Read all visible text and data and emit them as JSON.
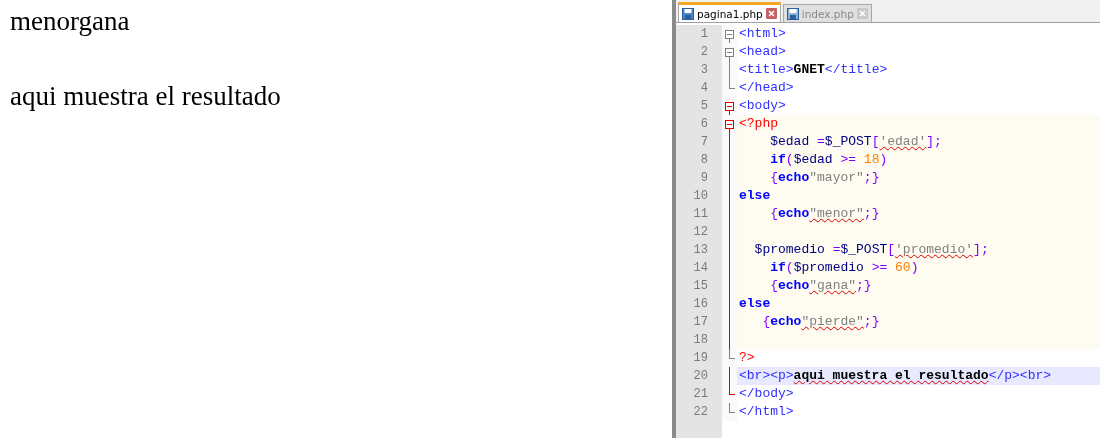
{
  "page_output": {
    "lines": [
      "menorgana",
      "aqui muestra el resultado"
    ]
  },
  "editor": {
    "tabs": [
      {
        "label": "pagina1.php",
        "selected": true
      },
      {
        "label": "index.php",
        "selected": false
      }
    ],
    "lines": [
      {
        "number": "1",
        "fold_start": true,
        "active_scope": false,
        "php_block": false,
        "current": false,
        "tokens": [
          {
            "kind": "tag",
            "text": "<html>"
          }
        ]
      },
      {
        "number": "2",
        "fold_start": true,
        "active_scope": false,
        "php_block": false,
        "current": false,
        "tokens": [
          {
            "kind": "tag",
            "text": "<head>"
          }
        ]
      },
      {
        "number": "3",
        "fold_start": false,
        "fold_end": false,
        "active_scope": false,
        "php_block": false,
        "current": false,
        "tokens": [
          {
            "kind": "tag",
            "text": "<title>"
          },
          {
            "kind": "text",
            "text": "GNET"
          },
          {
            "kind": "tag",
            "text": "</title>"
          }
        ]
      },
      {
        "number": "4",
        "fold_start": false,
        "fold_end": true,
        "active_scope": false,
        "php_block": false,
        "current": false,
        "tokens": [
          {
            "kind": "tag",
            "text": "</head>"
          }
        ]
      },
      {
        "number": "5",
        "fold_start": true,
        "active_scope": true,
        "php_block": false,
        "current": false,
        "tokens": [
          {
            "kind": "tag",
            "text": "<body>"
          }
        ]
      },
      {
        "number": "6",
        "fold_start": true,
        "active_scope": true,
        "php_block": true,
        "current": false,
        "tokens": [
          {
            "kind": "php",
            "text": "<?php"
          }
        ]
      },
      {
        "number": "7",
        "fold_start": false,
        "fold_end": false,
        "active_scope": true,
        "php_block": true,
        "current": false,
        "tokens": [
          {
            "kind": "var",
            "text": "    $edad"
          },
          {
            "kind": "op",
            "text": " ="
          },
          {
            "kind": "var",
            "text": "$_POST"
          },
          {
            "kind": "op",
            "text": "["
          },
          {
            "kind": "string",
            "text": "'edad'",
            "spell": true
          },
          {
            "kind": "op",
            "text": "];"
          }
        ]
      },
      {
        "number": "8",
        "fold_start": false,
        "fold_end": false,
        "active_scope": true,
        "php_block": true,
        "current": false,
        "tokens": [
          {
            "kind": "keyword",
            "text": "    if"
          },
          {
            "kind": "op",
            "text": "("
          },
          {
            "kind": "var",
            "text": "$edad"
          },
          {
            "kind": "op",
            "text": " >= "
          },
          {
            "kind": "number",
            "text": "18"
          },
          {
            "kind": "op",
            "text": ")"
          }
        ]
      },
      {
        "number": "9",
        "fold_start": false,
        "fold_end": false,
        "active_scope": true,
        "php_block": true,
        "current": false,
        "tokens": [
          {
            "kind": "op",
            "text": "    {"
          },
          {
            "kind": "keyword",
            "text": "echo"
          },
          {
            "kind": "string",
            "text": "\"mayor\""
          },
          {
            "kind": "op",
            "text": ";}"
          }
        ]
      },
      {
        "number": "10",
        "fold_start": false,
        "fold_end": false,
        "active_scope": true,
        "php_block": true,
        "current": false,
        "tokens": [
          {
            "kind": "keyword",
            "text": "else"
          }
        ]
      },
      {
        "number": "11",
        "fold_start": false,
        "fold_end": false,
        "active_scope": true,
        "php_block": true,
        "current": false,
        "tokens": [
          {
            "kind": "op",
            "text": "    {"
          },
          {
            "kind": "keyword",
            "text": "echo"
          },
          {
            "kind": "string",
            "text": "\"menor\"",
            "spell": true
          },
          {
            "kind": "op",
            "text": ";}"
          }
        ]
      },
      {
        "number": "12",
        "fold_start": false,
        "fold_end": false,
        "active_scope": true,
        "php_block": true,
        "current": false
      },
      {
        "number": "13",
        "fold_start": false,
        "fold_end": false,
        "active_scope": true,
        "php_block": true,
        "current": false,
        "tokens": [
          {
            "kind": "var",
            "text": "  $promedio"
          },
          {
            "kind": "op",
            "text": " ="
          },
          {
            "kind": "var",
            "text": "$_POST"
          },
          {
            "kind": "op",
            "text": "["
          },
          {
            "kind": "string",
            "text": "'promedio'",
            "spell": true
          },
          {
            "kind": "op",
            "text": "];"
          }
        ]
      },
      {
        "number": "14",
        "fold_start": false,
        "fold_end": false,
        "active_scope": true,
        "php_block": true,
        "current": false,
        "tokens": [
          {
            "kind": "keyword",
            "text": "    if"
          },
          {
            "kind": "op",
            "text": "("
          },
          {
            "kind": "var",
            "text": "$promedio"
          },
          {
            "kind": "op",
            "text": " >= "
          },
          {
            "kind": "number",
            "text": "60"
          },
          {
            "kind": "op",
            "text": ")"
          }
        ]
      },
      {
        "number": "15",
        "fold_start": false,
        "fold_end": false,
        "active_scope": true,
        "php_block": true,
        "current": false,
        "tokens": [
          {
            "kind": "op",
            "text": "    {"
          },
          {
            "kind": "keyword",
            "text": "echo"
          },
          {
            "kind": "string",
            "text": "\"gana\"",
            "spell": true
          },
          {
            "kind": "op",
            "text": ";}"
          }
        ]
      },
      {
        "number": "16",
        "fold_start": false,
        "fold_end": false,
        "active_scope": true,
        "php_block": true,
        "current": false,
        "tokens": [
          {
            "kind": "keyword",
            "text": "else"
          }
        ]
      },
      {
        "number": "17",
        "fold_start": false,
        "fold_end": false,
        "active_scope": true,
        "php_block": true,
        "current": false,
        "tokens": [
          {
            "kind": "op",
            "text": "   {"
          },
          {
            "kind": "keyword",
            "text": "echo"
          },
          {
            "kind": "string",
            "text": "\"pierde\"",
            "spell": true
          },
          {
            "kind": "op",
            "text": ";}"
          }
        ]
      },
      {
        "number": "18",
        "fold_start": false,
        "fold_end": false,
        "active_scope": true,
        "php_block": true,
        "current": false
      },
      {
        "number": "19",
        "fold_start": false,
        "fold_end": true,
        "active_scope": false,
        "php_block": false,
        "current": false,
        "tokens": [
          {
            "kind": "php",
            "text": "?>"
          }
        ]
      },
      {
        "number": "20",
        "fold_start": false,
        "fold_end": false,
        "active_scope": true,
        "php_block": false,
        "current": true,
        "tokens": [
          {
            "kind": "tag",
            "text": "<br><p>"
          },
          {
            "kind": "text",
            "text": "aqui muestra el resultado",
            "spell": true
          },
          {
            "kind": "tag",
            "text": "</p><br>"
          }
        ]
      },
      {
        "number": "21",
        "fold_start": false,
        "fold_end": true,
        "active_scope": true,
        "php_block": false,
        "current": false,
        "tokens": [
          {
            "kind": "tag",
            "text": "</body>"
          }
        ]
      },
      {
        "number": "22",
        "fold_start": false,
        "fold_end": true,
        "active_scope": false,
        "php_block": false,
        "current": false,
        "tokens": [
          {
            "kind": "tag",
            "text": "</html>"
          }
        ]
      }
    ]
  }
}
